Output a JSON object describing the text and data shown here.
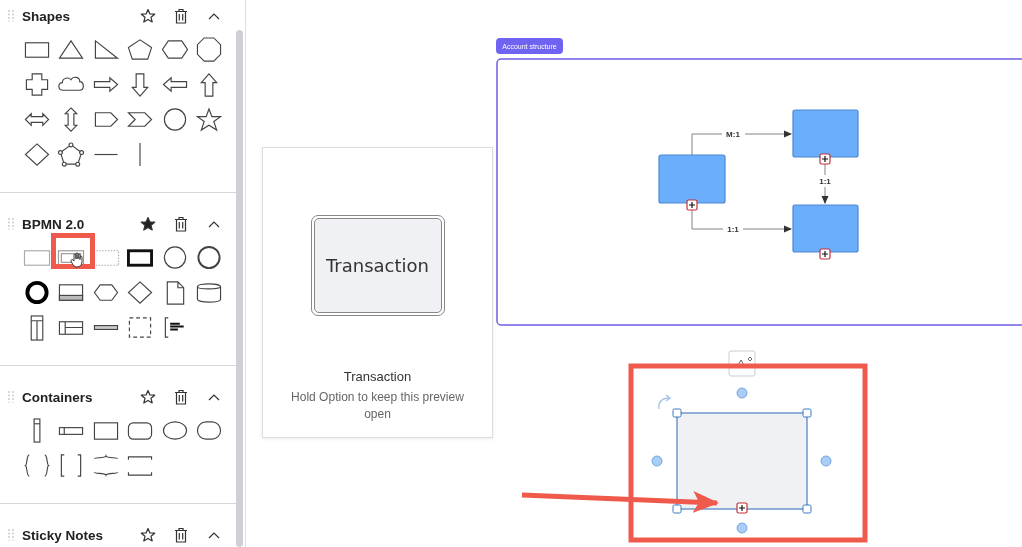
{
  "sidebar": {
    "sections": [
      {
        "title": "Shapes",
        "favorite": false,
        "expanded": true
      },
      {
        "title": "BPMN 2.0",
        "favorite": true,
        "expanded": true
      },
      {
        "title": "Containers",
        "favorite": false,
        "expanded": true
      },
      {
        "title": "Sticky Notes",
        "favorite": false,
        "expanded": true
      }
    ]
  },
  "preview": {
    "shape_text": "Transaction",
    "title": "Transaction",
    "hint": "Hold Option to keep this preview open"
  },
  "canvas": {
    "container": {
      "label": "Account structure"
    },
    "connectors": [
      {
        "label": "M:1"
      },
      {
        "label": "1:1"
      },
      {
        "label": "1:1"
      }
    ]
  }
}
